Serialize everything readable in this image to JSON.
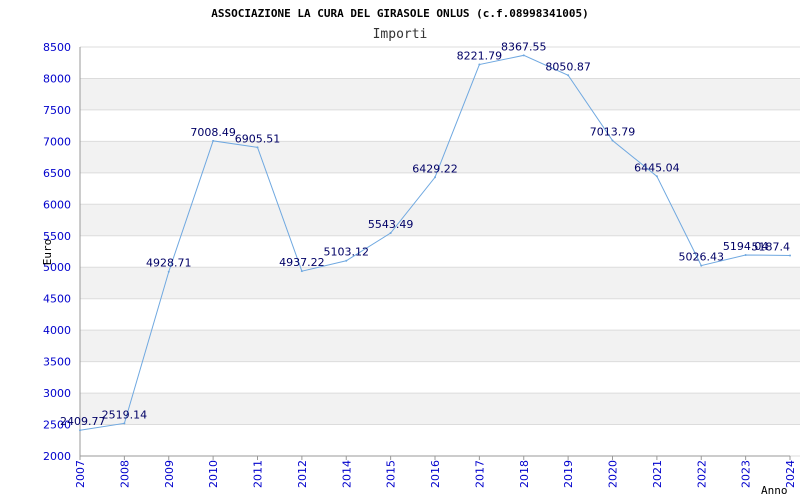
{
  "chart_data": {
    "type": "line",
    "title": "ASSOCIAZIONE LA CURA DEL GIRASOLE ONLUS (c.f.08998341005)",
    "subtitle": "Importi",
    "xlabel": "Anno",
    "ylabel": "Euro",
    "ylim": [
      2000,
      8500
    ],
    "yticks": [
      "2000",
      "2500",
      "3000",
      "3500",
      "4000",
      "4500",
      "5000",
      "5500",
      "6000",
      "6500",
      "7000",
      "7500",
      "8000",
      "8500"
    ],
    "categories": [
      "2007",
      "2008",
      "2009",
      "2010",
      "2011",
      "2012",
      "2014",
      "2015",
      "2016",
      "2017",
      "2018",
      "2019",
      "2020",
      "2021",
      "2022",
      "2023",
      "2024"
    ],
    "values": [
      2409.77,
      2519.14,
      4928.71,
      7008.49,
      6905.51,
      4937.22,
      5103.12,
      5543.49,
      6429.22,
      8221.79,
      8367.55,
      8050.87,
      7013.79,
      6445.04,
      5026.43,
      5194.04,
      5187.4
    ],
    "data_labels": [
      "2409.77",
      "2519.14",
      "4928.71",
      "7008.49",
      "6905.51",
      "4937.22",
      "5103.12",
      "5543.49",
      "6429.22",
      "8221.79",
      "8367.55",
      "8050.87",
      "7013.79",
      "6445.04",
      "5026.43",
      "5194.04",
      "5187.4"
    ],
    "grid": "horizontal-bands",
    "colors": {
      "line": "#6fa8e0",
      "tick_text": "#0000cc",
      "label_text": "#000066",
      "band": "#f2f2f2",
      "grid": "#dcdcdc"
    }
  }
}
